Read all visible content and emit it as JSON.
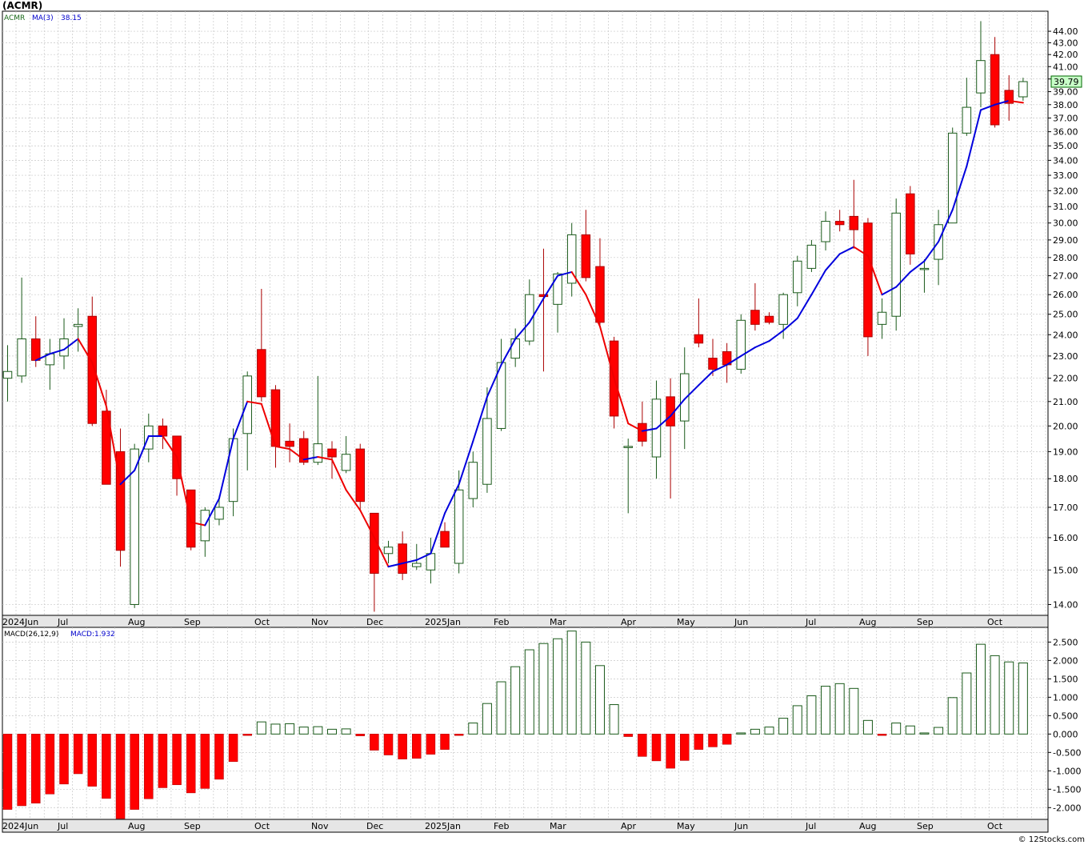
{
  "page": {
    "title": "(ACMR)",
    "credit": "© 12Stocks.com"
  },
  "legend_price": {
    "symbol": "ACMR",
    "ma_label": "MA(3)",
    "ma_value": "38.15"
  },
  "legend_macd": {
    "label": "MACD(26,12,9)",
    "value_label": "MACD:1.932"
  },
  "last_price_label": "39.79",
  "colors": {
    "up_fill": "#ffffff",
    "up_stroke": "#1a5a1a",
    "down_fill": "#ff0000",
    "down_stroke": "#aa0000",
    "ma_up": "#0000dd",
    "ma_down": "#ee0000",
    "macd_pos_stroke": "#1a5a1a",
    "macd_neg_fill": "#ff0000",
    "price_box_fill": "#c8ffc8",
    "grid": "#c8c8c8"
  },
  "chart_data": [
    {
      "type": "candlestick",
      "title": "",
      "x_labels": [
        "2024Jun",
        "Jul",
        "Aug",
        "Sep",
        "Oct",
        "Nov",
        "Dec",
        "2025Jan",
        "Feb",
        "Mar",
        "Apr",
        "May",
        "Jun",
        "Jul",
        "Aug",
        "Sep",
        "Oct"
      ],
      "y_ticks": [
        "14.00",
        "15.00",
        "16.00",
        "17.00",
        "18.00",
        "19.00",
        "20.00",
        "21.00",
        "22.00",
        "23.00",
        "24.00",
        "25.00",
        "26.00",
        "27.00",
        "28.00",
        "29.00",
        "30.00",
        "31.00",
        "32.00",
        "33.00",
        "34.00",
        "35.00",
        "36.00",
        "37.00",
        "38.00",
        "39.00",
        "40.00",
        "41.00",
        "42.00",
        "43.00",
        "44.00"
      ],
      "y_scale": "log",
      "ylim": [
        13.7,
        45.8
      ],
      "bars": [
        {
          "o": 22.0,
          "h": 23.5,
          "l": 21.0,
          "c": 22.3
        },
        {
          "o": 22.1,
          "h": 26.9,
          "l": 21.8,
          "c": 23.8
        },
        {
          "o": 23.8,
          "h": 24.9,
          "l": 22.5,
          "c": 22.8
        },
        {
          "o": 22.6,
          "h": 23.8,
          "l": 21.5,
          "c": 23.1
        },
        {
          "o": 23.0,
          "h": 24.8,
          "l": 22.4,
          "c": 23.8
        },
        {
          "o": 24.4,
          "h": 25.3,
          "l": 23.2,
          "c": 24.5
        },
        {
          "o": 24.9,
          "h": 25.9,
          "l": 20.0,
          "c": 20.1
        },
        {
          "o": 20.6,
          "h": 21.5,
          "l": 18.1,
          "c": 17.8
        },
        {
          "o": 19.0,
          "h": 19.9,
          "l": 15.1,
          "c": 15.6
        },
        {
          "o": 14.0,
          "h": 19.3,
          "l": 13.9,
          "c": 19.1
        },
        {
          "o": 19.1,
          "h": 20.5,
          "l": 18.6,
          "c": 20.0
        },
        {
          "o": 20.0,
          "h": 20.3,
          "l": 19.1,
          "c": 19.6
        },
        {
          "o": 19.6,
          "h": 19.6,
          "l": 17.4,
          "c": 18.0
        },
        {
          "o": 17.6,
          "h": 17.6,
          "l": 15.6,
          "c": 15.7
        },
        {
          "o": 15.9,
          "h": 17.0,
          "l": 15.4,
          "c": 16.9
        },
        {
          "o": 16.6,
          "h": 17.4,
          "l": 16.4,
          "c": 17.0
        },
        {
          "o": 17.2,
          "h": 19.9,
          "l": 16.7,
          "c": 19.5
        },
        {
          "o": 19.7,
          "h": 22.3,
          "l": 18.3,
          "c": 22.1
        },
        {
          "o": 23.3,
          "h": 26.3,
          "l": 21.0,
          "c": 21.2
        },
        {
          "o": 21.5,
          "h": 21.7,
          "l": 18.4,
          "c": 19.2
        },
        {
          "o": 19.4,
          "h": 20.1,
          "l": 18.6,
          "c": 19.2
        },
        {
          "o": 19.5,
          "h": 19.8,
          "l": 18.5,
          "c": 18.6
        },
        {
          "o": 18.6,
          "h": 22.1,
          "l": 18.5,
          "c": 19.3
        },
        {
          "o": 19.1,
          "h": 19.4,
          "l": 18.0,
          "c": 18.8
        },
        {
          "o": 18.3,
          "h": 19.6,
          "l": 18.2,
          "c": 18.9
        },
        {
          "o": 19.1,
          "h": 19.3,
          "l": 16.9,
          "c": 17.2
        },
        {
          "o": 16.8,
          "h": 16.8,
          "l": 13.8,
          "c": 14.9
        },
        {
          "o": 15.5,
          "h": 15.9,
          "l": 15.2,
          "c": 15.7
        },
        {
          "o": 15.8,
          "h": 16.2,
          "l": 14.7,
          "c": 14.9
        },
        {
          "o": 15.1,
          "h": 15.8,
          "l": 15.0,
          "c": 15.2
        },
        {
          "o": 15.0,
          "h": 16.0,
          "l": 14.6,
          "c": 15.5
        },
        {
          "o": 16.2,
          "h": 16.5,
          "l": 15.8,
          "c": 15.7
        },
        {
          "o": 15.2,
          "h": 18.3,
          "l": 14.9,
          "c": 17.6
        },
        {
          "o": 17.3,
          "h": 19.0,
          "l": 17.0,
          "c": 18.6
        },
        {
          "o": 17.8,
          "h": 21.6,
          "l": 17.5,
          "c": 20.3
        },
        {
          "o": 19.9,
          "h": 23.8,
          "l": 19.8,
          "c": 22.7
        },
        {
          "o": 22.9,
          "h": 24.3,
          "l": 22.5,
          "c": 23.8
        },
        {
          "o": 23.7,
          "h": 26.8,
          "l": 23.5,
          "c": 26.0
        },
        {
          "o": 26.0,
          "h": 28.5,
          "l": 22.3,
          "c": 25.9
        },
        {
          "o": 25.5,
          "h": 27.2,
          "l": 24.1,
          "c": 27.1
        },
        {
          "o": 26.6,
          "h": 30.0,
          "l": 25.9,
          "c": 29.3
        },
        {
          "o": 29.3,
          "h": 30.8,
          "l": 26.7,
          "c": 26.9
        },
        {
          "o": 27.5,
          "h": 29.1,
          "l": 24.4,
          "c": 24.6
        },
        {
          "o": 23.7,
          "h": 23.9,
          "l": 19.9,
          "c": 20.4
        },
        {
          "o": 19.2,
          "h": 19.5,
          "l": 16.8,
          "c": 19.2
        },
        {
          "o": 20.1,
          "h": 21.0,
          "l": 19.2,
          "c": 19.4
        },
        {
          "o": 18.8,
          "h": 21.9,
          "l": 18.0,
          "c": 21.1
        },
        {
          "o": 21.2,
          "h": 22.0,
          "l": 17.3,
          "c": 20.0
        },
        {
          "o": 20.2,
          "h": 23.4,
          "l": 19.1,
          "c": 22.2
        },
        {
          "o": 24.0,
          "h": 25.8,
          "l": 23.4,
          "c": 23.6
        },
        {
          "o": 22.9,
          "h": 23.8,
          "l": 22.1,
          "c": 22.4
        },
        {
          "o": 23.2,
          "h": 23.6,
          "l": 21.8,
          "c": 22.6
        },
        {
          "o": 22.4,
          "h": 25.0,
          "l": 22.2,
          "c": 24.7
        },
        {
          "o": 25.2,
          "h": 26.6,
          "l": 24.2,
          "c": 24.5
        },
        {
          "o": 24.9,
          "h": 25.1,
          "l": 24.5,
          "c": 24.6
        },
        {
          "o": 24.5,
          "h": 26.1,
          "l": 23.8,
          "c": 26.0
        },
        {
          "o": 26.1,
          "h": 28.1,
          "l": 25.4,
          "c": 27.8
        },
        {
          "o": 27.4,
          "h": 29.0,
          "l": 27.2,
          "c": 28.7
        },
        {
          "o": 28.9,
          "h": 30.7,
          "l": 28.4,
          "c": 30.1
        },
        {
          "o": 30.1,
          "h": 30.8,
          "l": 29.5,
          "c": 29.9
        },
        {
          "o": 30.4,
          "h": 32.7,
          "l": 28.5,
          "c": 29.6
        },
        {
          "o": 30.0,
          "h": 30.3,
          "l": 23.0,
          "c": 23.9
        },
        {
          "o": 24.5,
          "h": 25.8,
          "l": 23.8,
          "c": 25.1
        },
        {
          "o": 24.9,
          "h": 31.5,
          "l": 24.2,
          "c": 30.6
        },
        {
          "o": 31.8,
          "h": 32.3,
          "l": 27.6,
          "c": 28.2
        },
        {
          "o": 27.4,
          "h": 27.9,
          "l": 26.1,
          "c": 27.4
        },
        {
          "o": 27.9,
          "h": 30.8,
          "l": 26.5,
          "c": 29.9
        },
        {
          "o": 30.0,
          "h": 36.3,
          "l": 30.0,
          "c": 35.9
        },
        {
          "o": 35.9,
          "h": 40.1,
          "l": 35.7,
          "c": 37.8
        },
        {
          "o": 38.9,
          "h": 44.9,
          "l": 37.8,
          "c": 41.5
        },
        {
          "o": 42.0,
          "h": 43.5,
          "l": 36.3,
          "c": 36.5
        },
        {
          "o": 39.1,
          "h": 40.3,
          "l": 36.8,
          "c": 38.1
        },
        {
          "o": 38.6,
          "h": 40.1,
          "l": 38.3,
          "c": 39.79
        }
      ],
      "ma3": [
        null,
        null,
        22.8,
        23.1,
        23.3,
        23.8,
        22.7,
        20.8,
        17.8,
        18.3,
        19.6,
        19.6,
        18.8,
        16.5,
        16.4,
        17.3,
        19.5,
        21.0,
        20.9,
        19.2,
        19.1,
        18.7,
        18.8,
        18.7,
        17.6,
        16.9,
        16.0,
        15.1,
        15.2,
        15.3,
        15.5,
        16.8,
        17.8,
        19.4,
        21.2,
        22.6,
        23.8,
        24.6,
        25.8,
        27.0,
        27.2,
        26.0,
        24.4,
        22.0,
        20.1,
        19.8,
        19.9,
        20.4,
        21.1,
        21.7,
        22.3,
        22.6,
        23.0,
        23.4,
        23.7,
        24.2,
        24.8,
        26.0,
        27.3,
        28.2,
        28.6,
        28.1,
        26.0,
        26.4,
        27.2,
        27.8,
        28.9,
        30.8,
        33.6,
        37.6,
        38.0,
        38.3,
        38.15
      ]
    },
    {
      "type": "bar",
      "title": "",
      "name": "MACD(26,12,9)",
      "y_ticks": [
        "-2.000",
        "-1.500",
        "-1.000",
        "-0.500",
        "0.000",
        "0.500",
        "1.000",
        "1.500",
        "2.000",
        "2.500"
      ],
      "ylim": [
        -2.32,
        2.9
      ],
      "values": [
        -2.05,
        -1.95,
        -1.88,
        -1.63,
        -1.36,
        -1.08,
        -1.42,
        -1.75,
        -2.3,
        -2.05,
        -1.76,
        -1.46,
        -1.38,
        -1.6,
        -1.48,
        -1.23,
        -0.75,
        -0.04,
        0.33,
        0.27,
        0.28,
        0.19,
        0.2,
        0.13,
        0.14,
        -0.05,
        -0.44,
        -0.57,
        -0.68,
        -0.66,
        -0.55,
        -0.42,
        -0.04,
        0.3,
        0.83,
        1.42,
        1.83,
        2.29,
        2.46,
        2.59,
        2.8,
        2.5,
        1.86,
        0.8,
        -0.07,
        -0.61,
        -0.73,
        -0.93,
        -0.72,
        -0.42,
        -0.35,
        -0.28,
        0.03,
        0.13,
        0.19,
        0.43,
        0.77,
        1.04,
        1.3,
        1.37,
        1.24,
        0.37,
        -0.04,
        0.3,
        0.22,
        0.03,
        0.18,
        0.99,
        1.66,
        2.44,
        2.13,
        1.96,
        1.932
      ]
    }
  ]
}
